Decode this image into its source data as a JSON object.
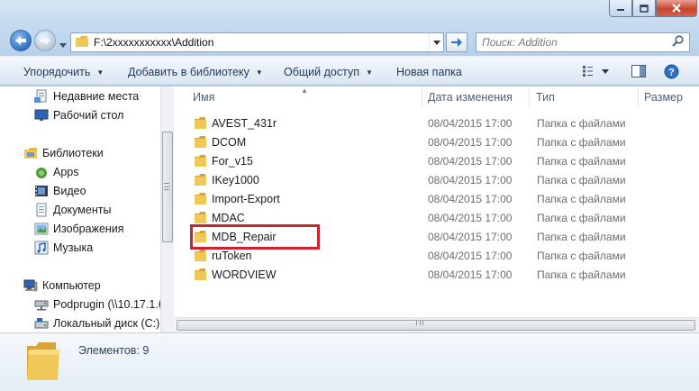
{
  "address": {
    "path": "F:\\2xxxxxxxxxxx\\Addition"
  },
  "search": {
    "placeholder": "Поиск: Addition"
  },
  "toolbar": {
    "organize": "Упорядочить",
    "add_to_library": "Добавить в библиотеку",
    "share": "Общий доступ",
    "new_folder": "Новая папка"
  },
  "nav": {
    "items": [
      {
        "label": "Недавние места",
        "icon": "recent-places-icon"
      },
      {
        "label": "Рабочий стол",
        "icon": "desktop-icon"
      },
      {
        "label": "Библиотеки",
        "icon": "libraries-icon"
      },
      {
        "label": "Apps",
        "icon": "apps-icon"
      },
      {
        "label": "Видео",
        "icon": "video-icon"
      },
      {
        "label": "Документы",
        "icon": "documents-icon"
      },
      {
        "label": "Изображения",
        "icon": "pictures-icon"
      },
      {
        "label": "Музыка",
        "icon": "music-icon"
      },
      {
        "label": "Компьютер",
        "icon": "computer-icon"
      },
      {
        "label": "Podprugin (\\\\10.17.1.6",
        "icon": "network-drive-icon"
      },
      {
        "label": "Локальный диск (C:)",
        "icon": "local-disk-icon"
      }
    ]
  },
  "columns": {
    "name": "Имя",
    "date": "Дата изменения",
    "type": "Тип",
    "size": "Размер"
  },
  "files": [
    {
      "name": "AVEST_431r",
      "date": "08/04/2015 17:00",
      "type": "Папка с файлами"
    },
    {
      "name": "DCOM",
      "date": "08/04/2015 17:00",
      "type": "Папка с файлами"
    },
    {
      "name": "For_v15",
      "date": "08/04/2015 17:00",
      "type": "Папка с файлами"
    },
    {
      "name": "IKey1000",
      "date": "08/04/2015 17:00",
      "type": "Папка с файлами"
    },
    {
      "name": "Import-Export",
      "date": "08/04/2015 17:00",
      "type": "Папка с файлами"
    },
    {
      "name": "MDAC",
      "date": "08/04/2015 17:00",
      "type": "Папка с файлами"
    },
    {
      "name": "MDB_Repair",
      "date": "08/04/2015 17:00",
      "type": "Папка с файлами",
      "highlighted": true
    },
    {
      "name": "ruToken",
      "date": "08/04/2015 17:00",
      "type": "Папка с файлами"
    },
    {
      "name": "WORDVIEW",
      "date": "08/04/2015 17:00",
      "type": "Папка с файлами"
    }
  ],
  "details": {
    "count": "Элементов: 9"
  },
  "colors": {
    "highlight_border": "#d0202b",
    "folder": "#e8b94a",
    "toolbar_text": "#1e395b"
  }
}
